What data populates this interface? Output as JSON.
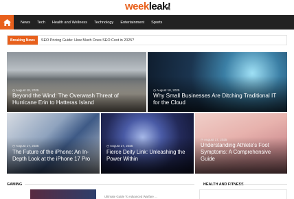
{
  "site": {
    "logo_part1": "week",
    "logo_part2": "leak!"
  },
  "nav": {
    "items": [
      "News",
      "Tech",
      "Health and Wellness",
      "Technology",
      "Entertainment",
      "Sports"
    ]
  },
  "breaking": {
    "label": "Breaking News",
    "headline": "SEO Pricing Guide: How Much Does SEO Cost in 2025?"
  },
  "cards": [
    {
      "date": "August 18, 2025",
      "title": "Beyond the Wind: The Overwash Threat of Hurricane Erin to Hatteras Island"
    },
    {
      "date": "August 18, 2025",
      "title": "Why Small Businesses Are Ditching Traditional IT for the Cloud"
    },
    {
      "date": "August 17, 2025",
      "title": "The Future of the iPhone: An In-Depth Look at the iPhone 17 Pro"
    },
    {
      "date": "August 17, 2025",
      "title": "Fierce Deity Link: Unleashing the Power Within"
    },
    {
      "date": "August 17, 2025",
      "title": "Understanding Athlete's Foot Symptoms: A Comprehensive Guide"
    }
  ],
  "sections": {
    "gaming": "GAMING",
    "health": "HEALTH AND FITNESS",
    "gaming_snippet": "Ultimate Guide To Advanced Warfare ..."
  },
  "colors": {
    "accent": "#e8601c",
    "nav_bg": "#222222"
  }
}
